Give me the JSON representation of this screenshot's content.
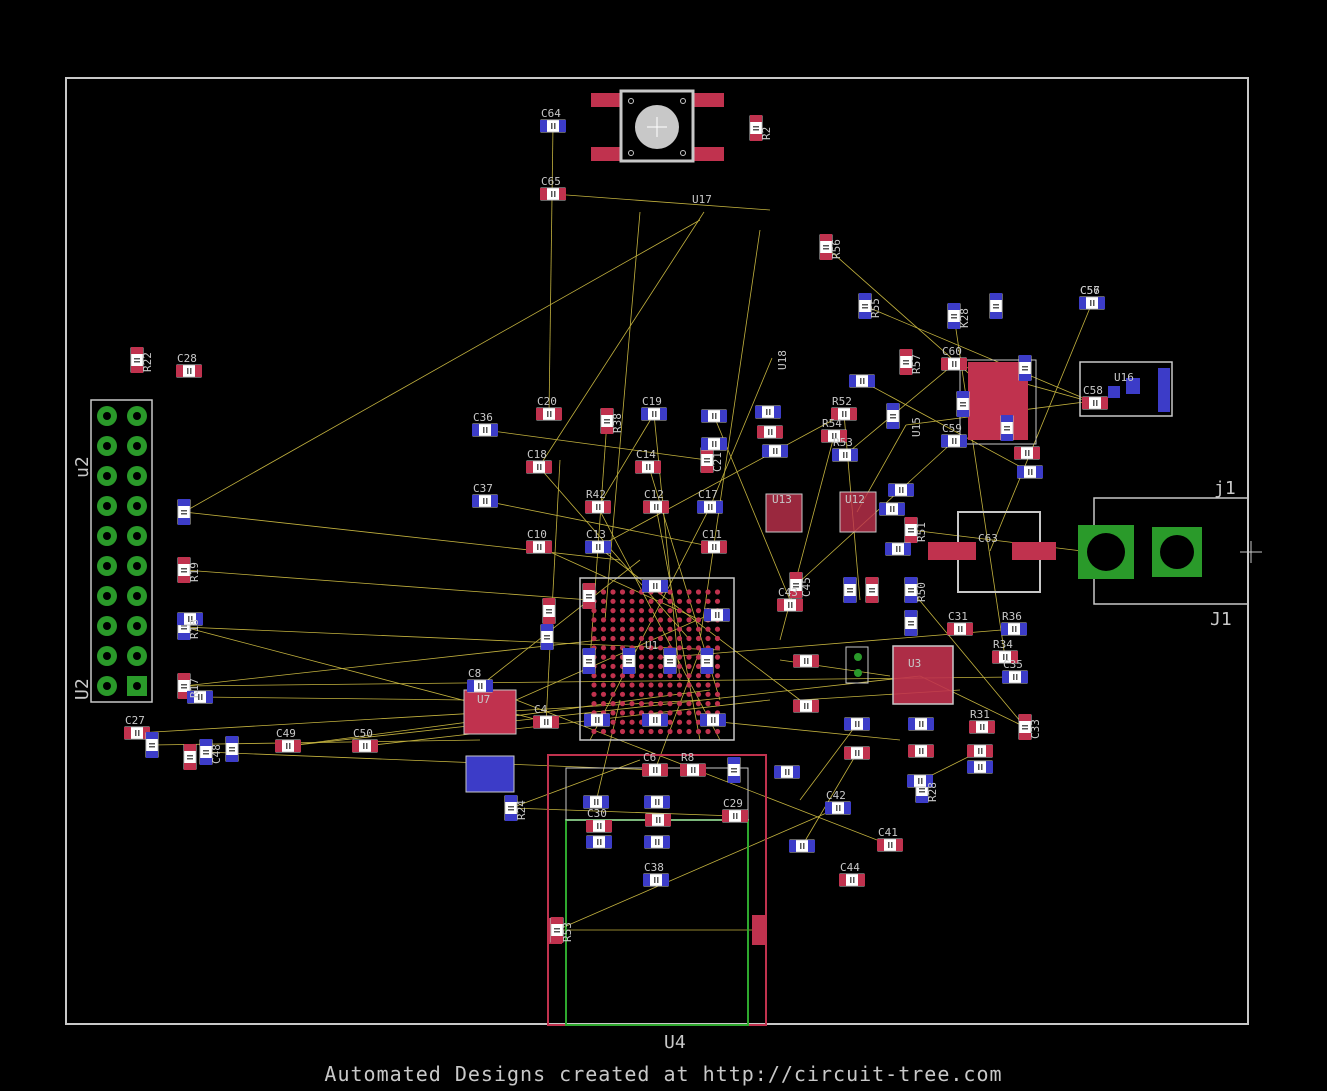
{
  "footer_text": "Automated Designs created at http://circuit-tree.com",
  "board_label": "U4",
  "colors": {
    "background": "#000000",
    "outline": "#c8c8c8",
    "top_pad": "#c0324e",
    "bottom_pad": "#3c3cc8",
    "airwire": "#e6d24a",
    "via_hole": "#2a9a2a"
  },
  "connectors": {
    "header": "u2",
    "header_mirror": "U2",
    "jack_top": "j1",
    "jack_bottom": "J1"
  },
  "components": [
    {
      "id": "c64",
      "ref": "C64"
    },
    {
      "id": "c65",
      "ref": "C65"
    },
    {
      "id": "r2",
      "ref": "R2"
    },
    {
      "id": "u17",
      "ref": "U17"
    },
    {
      "id": "r22",
      "ref": "R22"
    },
    {
      "id": "c28",
      "ref": "C28"
    },
    {
      "id": "c36",
      "ref": "C36"
    },
    {
      "id": "c20",
      "ref": "C20"
    },
    {
      "id": "r38",
      "ref": "R38"
    },
    {
      "id": "c19",
      "ref": "C19"
    },
    {
      "id": "c18",
      "ref": "C18"
    },
    {
      "id": "c14",
      "ref": "C14"
    },
    {
      "id": "c37",
      "ref": "C37"
    },
    {
      "id": "c21",
      "ref": "C21"
    },
    {
      "id": "c12",
      "ref": "C12"
    },
    {
      "id": "c17",
      "ref": "C17"
    },
    {
      "id": "r42",
      "ref": "R42"
    },
    {
      "id": "c10",
      "ref": "C10"
    },
    {
      "id": "c13",
      "ref": "C13"
    },
    {
      "id": "c11",
      "ref": "C11"
    },
    {
      "id": "u13",
      "ref": "U13"
    },
    {
      "id": "u12",
      "ref": "U12"
    },
    {
      "id": "u18",
      "ref": "U18"
    },
    {
      "id": "r56",
      "ref": "R56"
    },
    {
      "id": "r55",
      "ref": "R55"
    },
    {
      "id": "r52",
      "ref": "R52"
    },
    {
      "id": "r54",
      "ref": "R54"
    },
    {
      "id": "r53",
      "ref": "R53"
    },
    {
      "id": "u15",
      "ref": "U15"
    },
    {
      "id": "c56",
      "ref": "C56"
    },
    {
      "id": "c57",
      "ref": "C57"
    },
    {
      "id": "c58",
      "ref": "C58"
    },
    {
      "id": "u16",
      "ref": "U16"
    },
    {
      "id": "c59",
      "ref": "C59"
    },
    {
      "id": "c60",
      "ref": "C60"
    },
    {
      "id": "r57",
      "ref": "R57"
    },
    {
      "id": "k28",
      "ref": "K28"
    },
    {
      "id": "c63",
      "ref": "C63"
    },
    {
      "id": "r51",
      "ref": "R51"
    },
    {
      "id": "r50",
      "ref": "R50"
    },
    {
      "id": "c45",
      "ref": "C45"
    },
    {
      "id": "c43",
      "ref": "C43"
    },
    {
      "id": "r36",
      "ref": "R36"
    },
    {
      "id": "r34",
      "ref": "R34"
    },
    {
      "id": "c31",
      "ref": "C31"
    },
    {
      "id": "c35",
      "ref": "C35"
    },
    {
      "id": "c33",
      "ref": "C33"
    },
    {
      "id": "r31",
      "ref": "R31"
    },
    {
      "id": "u3",
      "ref": "U3"
    },
    {
      "id": "u1",
      "ref": "U1"
    },
    {
      "id": "r19",
      "ref": "R19"
    },
    {
      "id": "r18",
      "ref": "R18"
    },
    {
      "id": "r17",
      "ref": "R17"
    },
    {
      "id": "c27",
      "ref": "C27"
    },
    {
      "id": "c48",
      "ref": "C48"
    },
    {
      "id": "c49",
      "ref": "C49"
    },
    {
      "id": "c50",
      "ref": "C50"
    },
    {
      "id": "c8",
      "ref": "C8"
    },
    {
      "id": "c4",
      "ref": "C4"
    },
    {
      "id": "u7",
      "ref": "U7"
    },
    {
      "id": "r24",
      "ref": "R24"
    },
    {
      "id": "c6",
      "ref": "C6"
    },
    {
      "id": "r8",
      "ref": "R8"
    },
    {
      "id": "c42",
      "ref": "C42"
    },
    {
      "id": "c41",
      "ref": "C41"
    },
    {
      "id": "c44",
      "ref": "C44"
    },
    {
      "id": "r28",
      "ref": "R28"
    },
    {
      "id": "c29",
      "ref": "C29"
    },
    {
      "id": "c30",
      "ref": "C30"
    },
    {
      "id": "c38",
      "ref": "C38"
    },
    {
      "id": "r53b",
      "ref": "R53"
    }
  ]
}
